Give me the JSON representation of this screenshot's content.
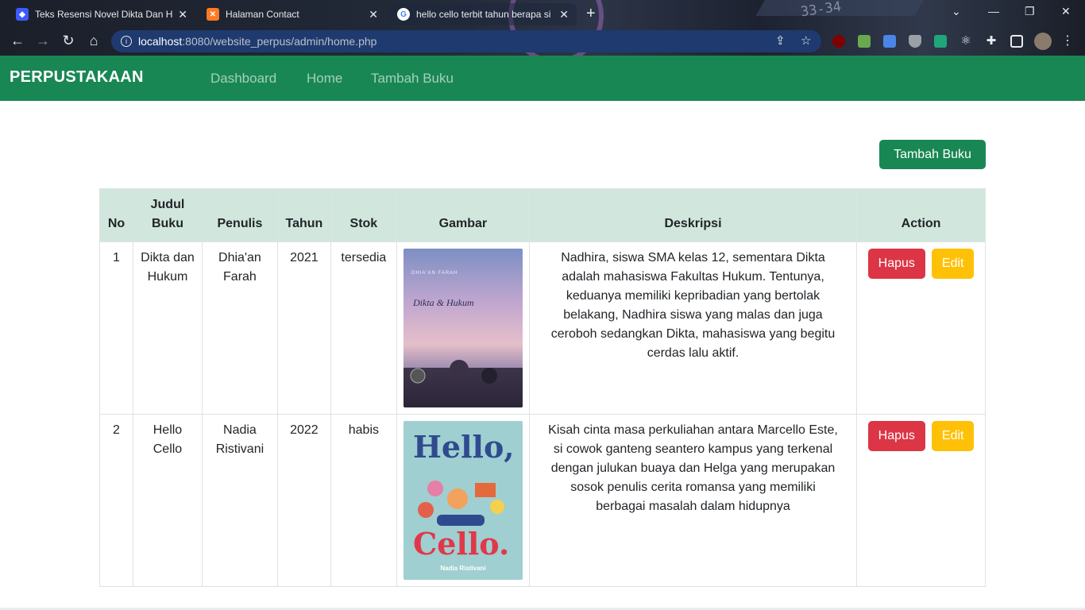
{
  "browser": {
    "tabs": [
      {
        "title": "Teks Resensi Novel Dikta Dan Hu",
        "icon": "brainly-icon"
      },
      {
        "title": "Halaman Contact",
        "icon": "xampp-icon"
      },
      {
        "title": "hello cello terbit tahun berapa si",
        "icon": "google-icon"
      }
    ],
    "address": {
      "host": "localhost",
      "path": ":8080/website_perpus/admin/home.php"
    },
    "decor_text": "33-34"
  },
  "navbar": {
    "brand": "PERPUSTAKAAN",
    "links": [
      "Dashboard",
      "Home",
      "Tambah Buku"
    ],
    "bg_color": "#198754"
  },
  "main": {
    "add_button": "Tambah Buku",
    "table": {
      "headers": [
        "No",
        "Judul Buku",
        "Penulis",
        "Tahun",
        "Stok",
        "Gambar",
        "Deskripsi",
        "Action"
      ],
      "rows": [
        {
          "no": "1",
          "judul": "Dikta dan Hukum",
          "penulis": "Dhia'an Farah",
          "tahun": "2021",
          "stok": "tersedia",
          "cover_title": "Dikta & Hukum",
          "cover_author": "DHIA'AN FARAH",
          "deskripsi": "Nadhira, siswa SMA kelas 12, sementara Dikta adalah mahasiswa Fakultas Hukum. Tentunya, keduanya memiliki kepribadian yang bertolak belakang, Nadhira siswa yang malas dan juga ceroboh sedangkan Dikta, mahasiswa yang begitu cerdas lalu aktif.",
          "hapus": "Hapus",
          "edit": "Edit"
        },
        {
          "no": "2",
          "judul": "Hello Cello",
          "penulis": "Nadia Ristivani",
          "tahun": "2022",
          "stok": "habis",
          "cover_title_1": "Hello,",
          "cover_title_2": "Cello.",
          "cover_author": "Nadia Ristivani",
          "deskripsi": "Kisah cinta masa perkuliahan antara Marcello Este, si cowok ganteng seantero kampus yang terkenal dengan julukan buaya dan Helga yang merupakan sosok penulis cerita romansa yang memiliki berbagai masalah dalam hidupnya",
          "hapus": "Hapus",
          "edit": "Edit"
        }
      ]
    }
  }
}
